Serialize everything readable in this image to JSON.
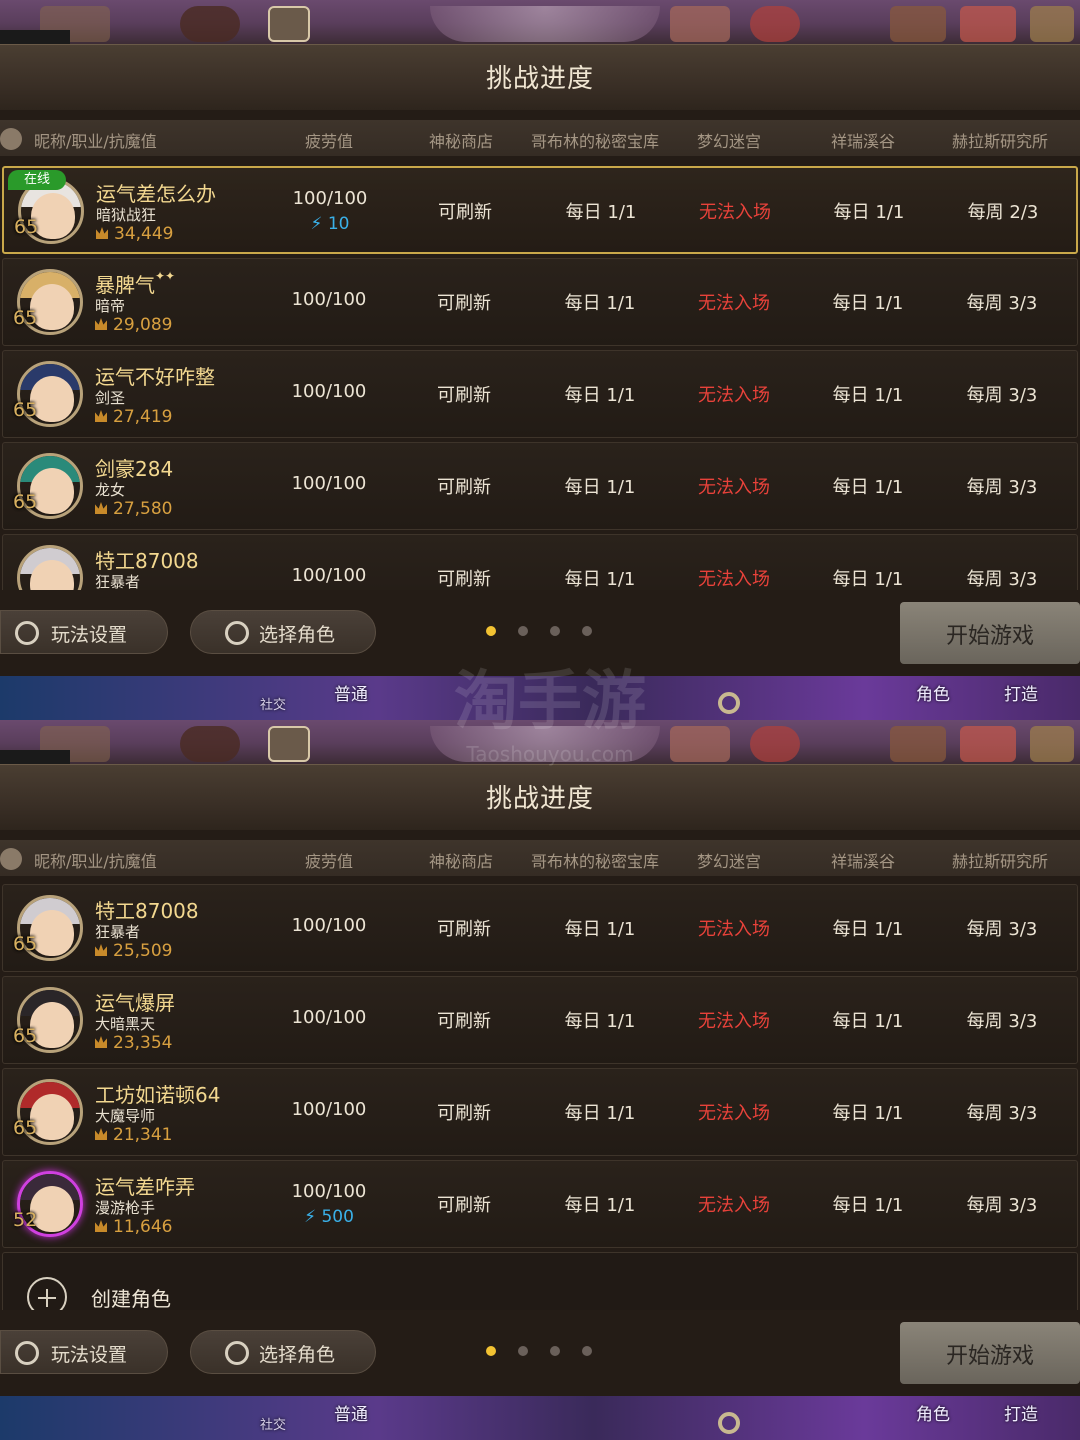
{
  "title": "挑战进度",
  "columns": [
    "昵称/职业/抗魔值",
    "疲劳值",
    "神秘商店",
    "哥布林的秘密宝库",
    "梦幻迷宫",
    "祥瑞溪谷",
    "赫拉斯研究所"
  ],
  "online_badge": "在线",
  "panel1": {
    "rows": [
      {
        "name": "运气差怎么办",
        "job": "暗狱战狂",
        "power": "34,449",
        "level": "65",
        "fatigue": "100/100",
        "fatigue_extra": "10",
        "shop": "可刷新",
        "goblin": "每日 1/1",
        "maze": "无法入场",
        "valley": "每日 1/1",
        "lab": "每周 2/3"
      },
      {
        "name": "暴脾气",
        "job": "暗帝",
        "power": "29,089",
        "level": "65",
        "fatigue": "100/100",
        "shop": "可刷新",
        "goblin": "每日 1/1",
        "maze": "无法入场",
        "valley": "每日 1/1",
        "lab": "每周 3/3"
      },
      {
        "name": "运气不好咋整",
        "job": "剑圣",
        "power": "27,419",
        "level": "65",
        "fatigue": "100/100",
        "shop": "可刷新",
        "goblin": "每日 1/1",
        "maze": "无法入场",
        "valley": "每日 1/1",
        "lab": "每周 3/3"
      },
      {
        "name": "剑豪284",
        "job": "龙女",
        "power": "27,580",
        "level": "65",
        "fatigue": "100/100",
        "shop": "可刷新",
        "goblin": "每日 1/1",
        "maze": "无法入场",
        "valley": "每日 1/1",
        "lab": "每周 3/3"
      },
      {
        "name": "特工87008",
        "job": "狂暴者",
        "fatigue": "100/100",
        "shop": "可刷新",
        "goblin": "每日 1/1",
        "maze": "无法入场",
        "valley": "每日 1/1",
        "lab": "每周 3/3"
      }
    ]
  },
  "panel2": {
    "rows": [
      {
        "name": "特工87008",
        "job": "狂暴者",
        "power": "25,509",
        "level": "65",
        "fatigue": "100/100",
        "shop": "可刷新",
        "goblin": "每日 1/1",
        "maze": "无法入场",
        "valley": "每日 1/1",
        "lab": "每周 3/3"
      },
      {
        "name": "运气爆屏",
        "job": "大暗黑天",
        "power": "23,354",
        "level": "65",
        "fatigue": "100/100",
        "shop": "可刷新",
        "goblin": "每日 1/1",
        "maze": "无法入场",
        "valley": "每日 1/1",
        "lab": "每周 3/3"
      },
      {
        "name": "工坊如诺顿64",
        "job": "大魔导师",
        "power": "21,341",
        "level": "65",
        "fatigue": "100/100",
        "shop": "可刷新",
        "goblin": "每日 1/1",
        "maze": "无法入场",
        "valley": "每日 1/1",
        "lab": "每周 3/3"
      },
      {
        "name": "运气差咋弄",
        "job": "漫游枪手",
        "power": "11,646",
        "level": "52",
        "fatigue": "100/100",
        "fatigue_extra": "500",
        "shop": "可刷新",
        "goblin": "每日 1/1",
        "maze": "无法入场",
        "valley": "每日 1/1",
        "lab": "每周 3/3"
      }
    ],
    "create_label": "创建角色"
  },
  "footer": {
    "settings_label": "玩法设置",
    "select_label": "选择角色",
    "start_label": "开始游戏",
    "page_count": 4,
    "active_page": 1
  },
  "bottom_bar": {
    "social": "社交",
    "normal": "普通",
    "character": "角色",
    "forge": "打造"
  },
  "watermark": {
    "main": "淘手游",
    "sub": "Taoshouyou.com"
  },
  "colors": {
    "gold": "#f3d890",
    "red_status": "#e8423a",
    "blue_fatigue": "#3ab0e8",
    "dot_active": "#f2c232",
    "online_green": "#2a9a2a"
  }
}
